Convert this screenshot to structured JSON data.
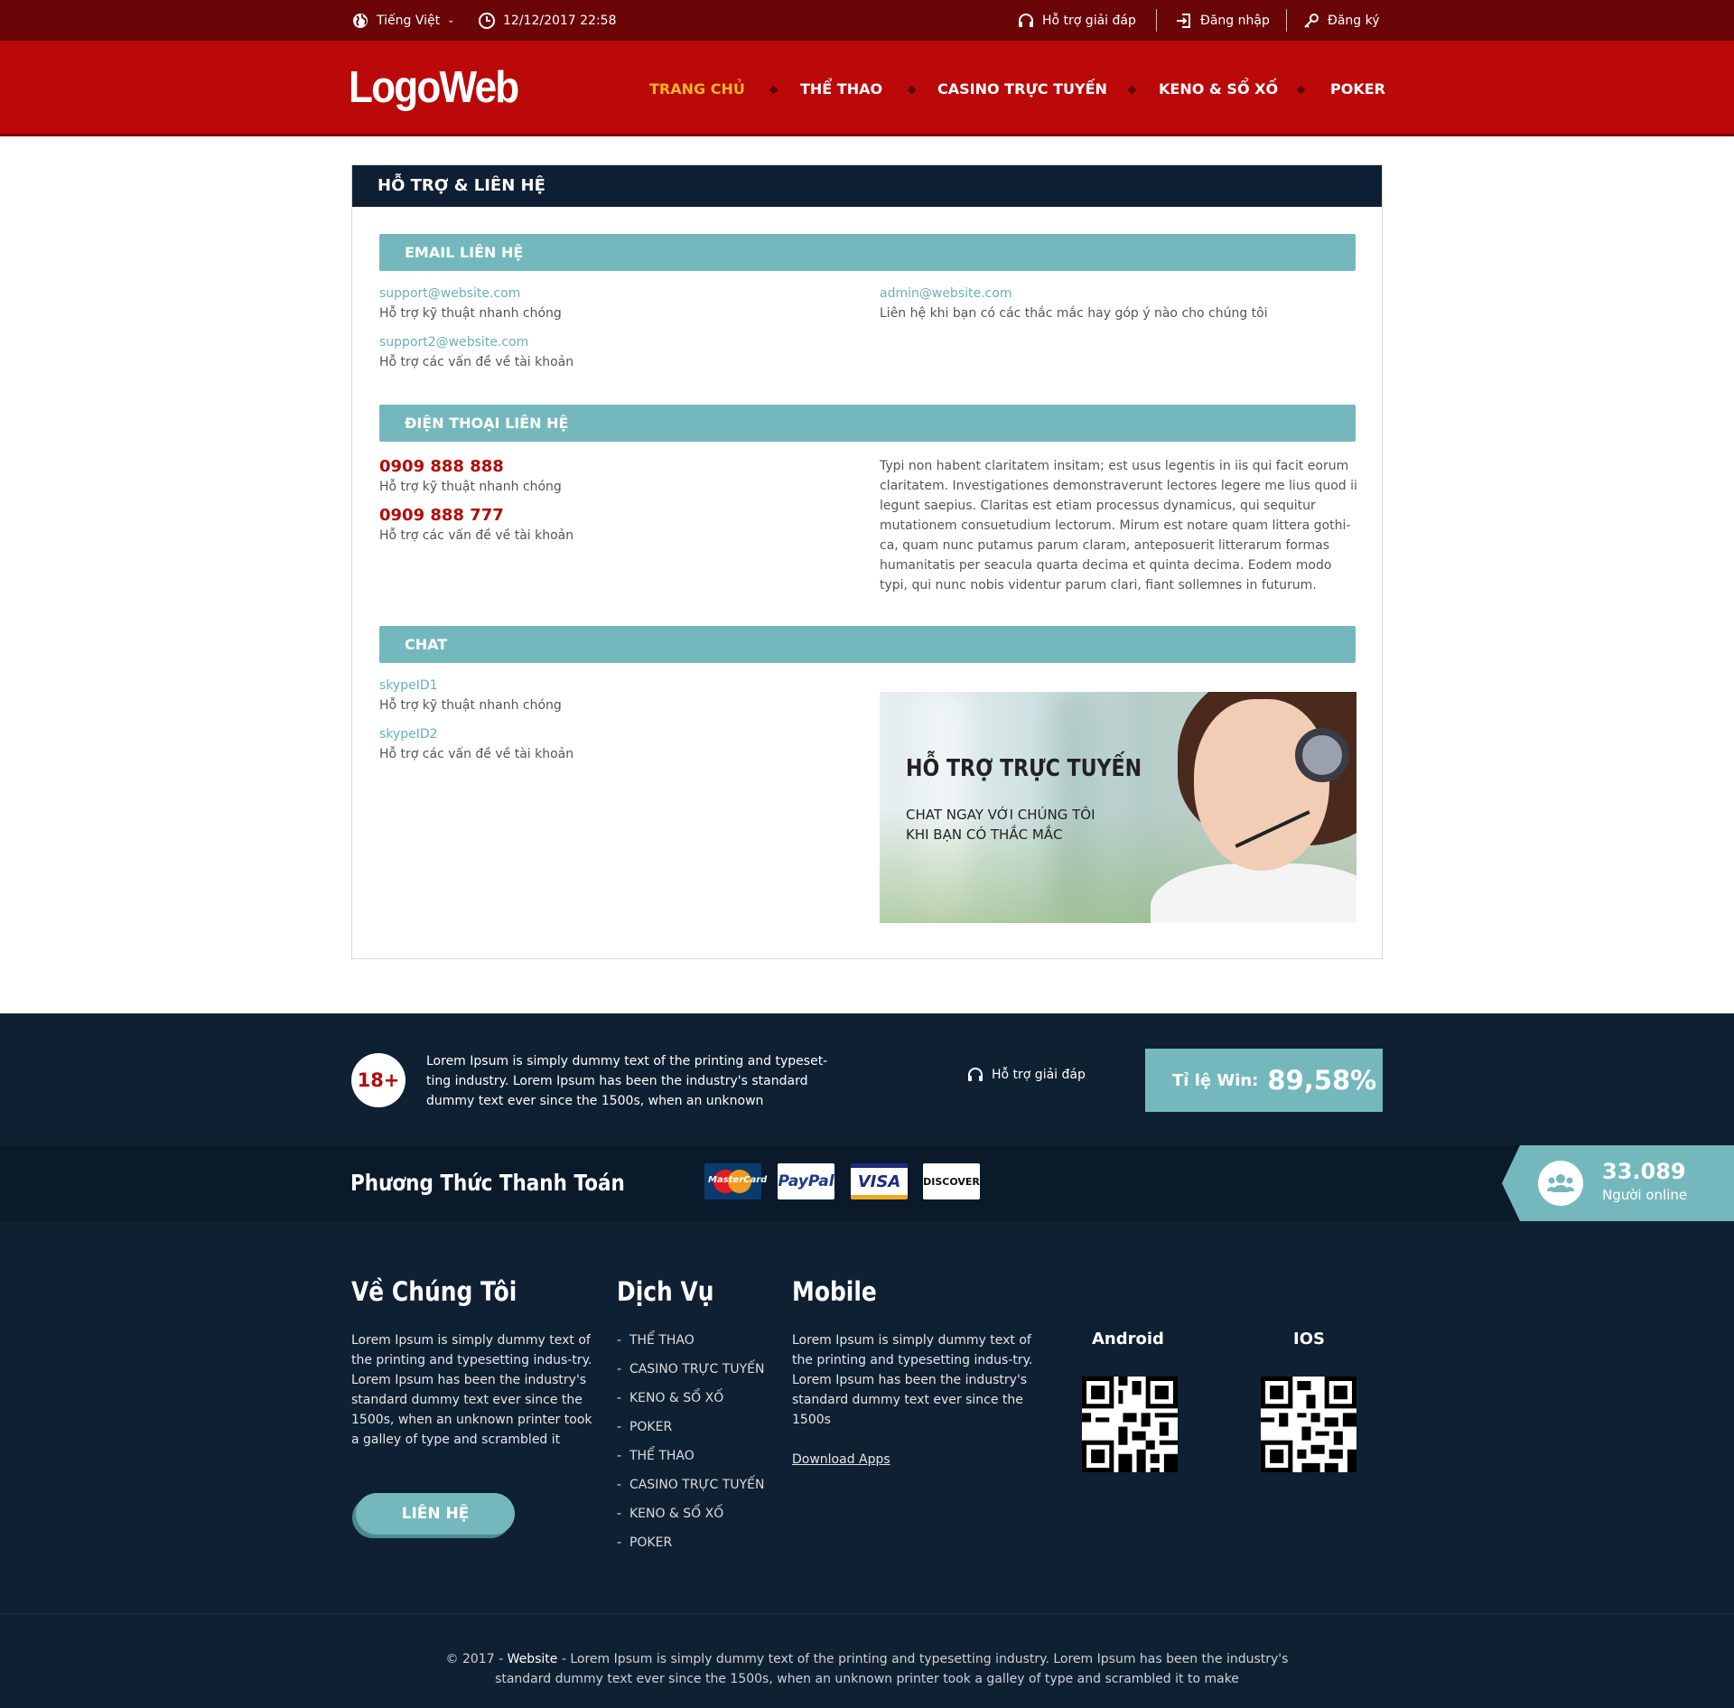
{
  "topbar": {
    "language": "Tiếng Việt",
    "datetime": "12/12/2017 22:58",
    "support": "Hỗ trợ giải đáp",
    "login": "Đăng nhập",
    "register": "Đăng ký"
  },
  "header": {
    "logo": "LogoWeb",
    "nav": [
      "TRANG CHỦ",
      "THỂ THAO",
      "CASINO TRỰC TUYẾN",
      "KENO & SỔ XỐ",
      "POKER"
    ]
  },
  "main": {
    "title": "HỖ TRỢ & LIÊN HỆ",
    "email": {
      "heading": "EMAIL LIÊN HỆ",
      "items": [
        {
          "email": "support@website.com",
          "desc": "Hỗ trợ kỹ thuật nhanh chóng"
        },
        {
          "email": "support2@website.com",
          "desc": "Hỗ trợ các vấn đề về tài khoản"
        },
        {
          "email": "admin@website.com",
          "desc": "Liên hệ khi bạn có các thắc mắc hay góp ý nào cho chúng tôi"
        }
      ]
    },
    "phone": {
      "heading": "ĐIỆN THOẠI LIÊN HỆ",
      "items": [
        {
          "number": "0909 888 888",
          "desc": "Hỗ trợ kỹ thuật nhanh chóng"
        },
        {
          "number": "0909 888 777",
          "desc": "Hỗ trợ các vấn đề về tài khoản"
        }
      ],
      "paragraph": "Typi non habent claritatem insitam; est usus legentis in iis qui facit eorum claritatem. Investigationes demonstraverunt lectores legere me lius quod ii legunt saepius. Claritas est etiam processus dynamicus, qui sequitur mutationem consuetudium lectorum. Mirum est notare quam littera gothi-ca, quam nunc putamus parum claram, anteposuerit litterarum formas humanitatis per seacula quarta decima et quinta decima. Eodem modo typi, qui nunc nobis videntur parum clari, fiant sollemnes in futurum."
    },
    "chat": {
      "heading": "CHAT",
      "items": [
        {
          "id": "skypeID1",
          "desc": "Hỗ trợ kỹ thuật nhanh chóng"
        },
        {
          "id": "skypeID2",
          "desc": "Hỗ trợ các vấn đề về tài khoản"
        }
      ],
      "banner_title": "HỖ TRỢ TRỰC TUYẾN",
      "banner_line1": "CHAT NGAY VỚI CHÚNG TÔI",
      "banner_line2": "KHI BẠN CÓ THẮC MẮC"
    }
  },
  "footer_top": {
    "age": "18+",
    "lorem": "Lorem Ipsum is simply dummy text of the printing and typeset-ting industry. Lorem Ipsum has been the industry's standard dummy text ever since the 1500s, when an unknown",
    "support": "Hỗ trợ giải đáp",
    "win_label": "Tỉ lệ Win:",
    "win_value": "89,58%"
  },
  "payment": {
    "title": "Phương Thức Thanh Toán",
    "cards": [
      "MasterCard",
      "PayPal",
      "VISA",
      "DISCOVER"
    ],
    "online_count": "33.089",
    "online_label": "Người online"
  },
  "footer": {
    "about_title": "Về Chúng Tôi",
    "about_text": "Lorem Ipsum is simply dummy text of the printing and typesetting indus-try. Lorem Ipsum has been the industry's standard dummy text ever since the 1500s, when an unknown printer took a galley of type and scrambled it",
    "contact_button": "LIÊN HỆ",
    "services_title": "Dịch Vụ",
    "services": [
      "THỂ THAO",
      "CASINO TRỰC TUYẾN",
      "KENO & SỔ XỐ",
      "POKER",
      "THỂ THAO",
      "CASINO TRỰC TUYẾN",
      "KENO & SỔ XỐ",
      "POKER"
    ],
    "mobile_title": "Mobile",
    "mobile_text": "Lorem Ipsum is simply dummy text of the printing and typesetting indus-try. Lorem Ipsum has been the industry's standard dummy text ever since the 1500s",
    "download": "Download Apps",
    "android": "Android",
    "ios": "IOS",
    "copyright_prefix": "© 2017 - ",
    "copyright_site": "Website",
    "copyright_text1": " - Lorem Ipsum is simply dummy text of the printing and typesetting industry. Lorem Ipsum has been the industry's",
    "copyright_text2": "standard dummy text ever since the 1500s, when an unknown printer took a galley of type and scrambled it to make"
  },
  "colors": {
    "topbar": "#6a0508",
    "header": "#bb0808",
    "accent_teal": "#74b8bd",
    "navy": "#0f2033",
    "nav_active": "#f0b528",
    "phone_red": "#b30a0a"
  }
}
